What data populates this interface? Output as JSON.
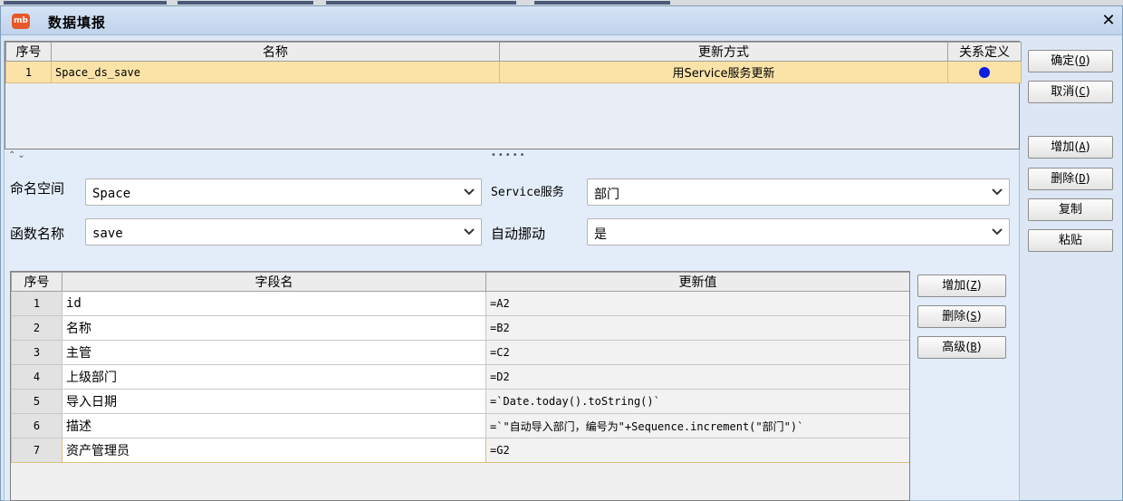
{
  "window": {
    "title": "数据填报",
    "app_icon_label": "mb"
  },
  "top_grid": {
    "columns": [
      "序号",
      "名称",
      "更新方式",
      "关系定义"
    ],
    "rows": [
      {
        "index": "1",
        "name": "Space_ds_save",
        "mode": "用Service服务更新"
      }
    ]
  },
  "side_buttons": {
    "ok": "确定",
    "ok_key": "O",
    "cancel": "取消",
    "cancel_key": "C",
    "add": "增加",
    "add_key": "A",
    "delete": "删除",
    "delete_key": "D",
    "copy": "复制",
    "paste": "粘贴"
  },
  "form": {
    "namespace_label": "命名空间",
    "namespace_value": "Space",
    "service_label": "Service服务",
    "service_value": "部门",
    "function_label": "函数名称",
    "function_value": "save",
    "auto_move_label": "自动挪动",
    "auto_move_value": "是"
  },
  "field_grid": {
    "columns": [
      "序号",
      "字段名",
      "更新值"
    ],
    "rows": [
      {
        "index": "1",
        "name": "id",
        "value": "=A2"
      },
      {
        "index": "2",
        "name": "名称",
        "value": "=B2"
      },
      {
        "index": "3",
        "name": "主管",
        "value": "=C2"
      },
      {
        "index": "4",
        "name": "上级部门",
        "value": "=D2"
      },
      {
        "index": "5",
        "name": "导入日期",
        "value": "=`Date.today().toString()`"
      },
      {
        "index": "6",
        "name": "描述",
        "value": "=`\"自动导入部门，编号为\"+Sequence.increment(\"部门\")`"
      },
      {
        "index": "7",
        "name": "资产管理员",
        "value": "=G2"
      }
    ],
    "selected_row": 7
  },
  "field_buttons": {
    "add": "增加",
    "add_key": "Z",
    "delete": "删除",
    "delete_key": "S",
    "advanced": "高级",
    "advanced_key": "B"
  },
  "colors": {
    "selected_row": "#fbe3a8",
    "relation_dot": "#0a1ee0",
    "window_bg": "#dce6f4"
  }
}
